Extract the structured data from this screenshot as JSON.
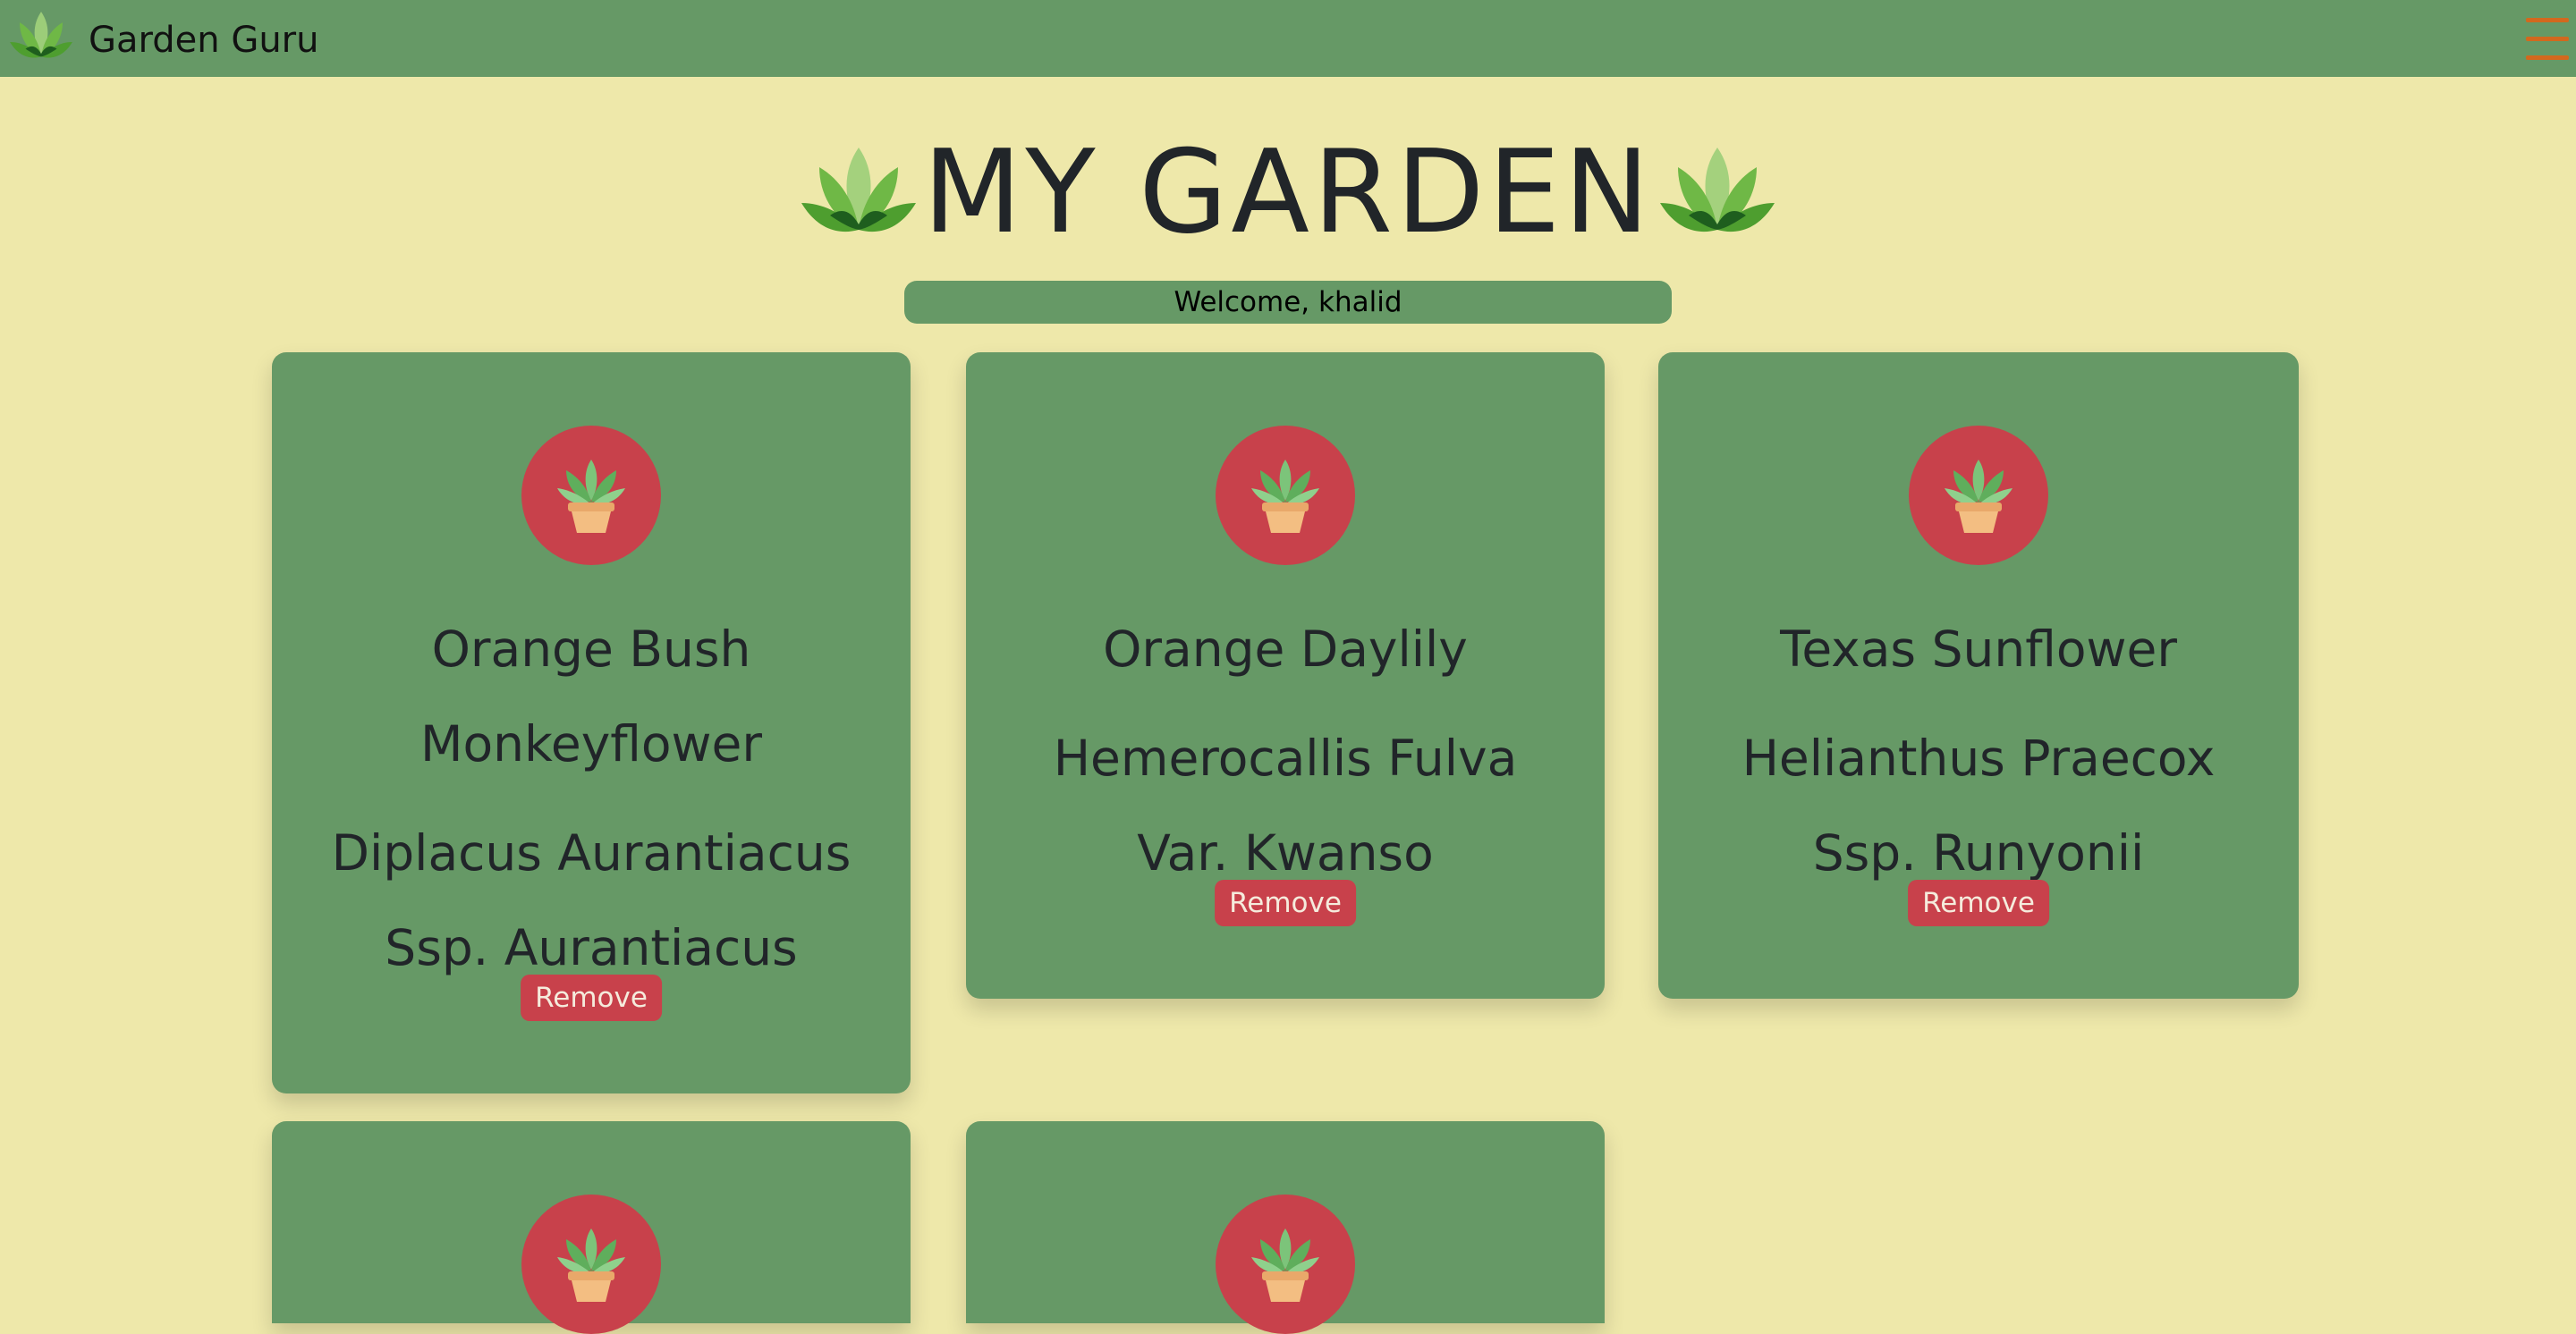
{
  "navbar": {
    "brand_name": "Garden Guru",
    "logo_icon": "leaf-logo-icon",
    "menu_icon": "hamburger-menu-icon",
    "menu_icon_color": "#D2691E",
    "background_color": "#669966"
  },
  "header": {
    "title": "MY GARDEN",
    "welcome_text": "Welcome, khalid"
  },
  "colors": {
    "page_background": "#EEE8AA",
    "card_background": "#669966",
    "accent_red": "#C8414B"
  },
  "plants": [
    {
      "common_name_lines": [
        "Orange Bush",
        "Monkeyflower"
      ],
      "scientific_name_lines": [
        "Diplacus Aurantiacus",
        "Ssp. Aurantiacus"
      ],
      "remove_label": "Remove"
    },
    {
      "common_name_lines": [
        "Orange Daylily"
      ],
      "scientific_name_lines": [
        "Hemerocallis Fulva",
        "Var. Kwanso"
      ],
      "remove_label": "Remove"
    },
    {
      "common_name_lines": [
        "Texas Sunflower"
      ],
      "scientific_name_lines": [
        "Helianthus Praecox",
        "Ssp. Runyonii"
      ],
      "remove_label": "Remove"
    },
    {
      "common_name_lines": [],
      "scientific_name_lines": [],
      "remove_label": ""
    },
    {
      "common_name_lines": [],
      "scientific_name_lines": [],
      "remove_label": ""
    }
  ]
}
